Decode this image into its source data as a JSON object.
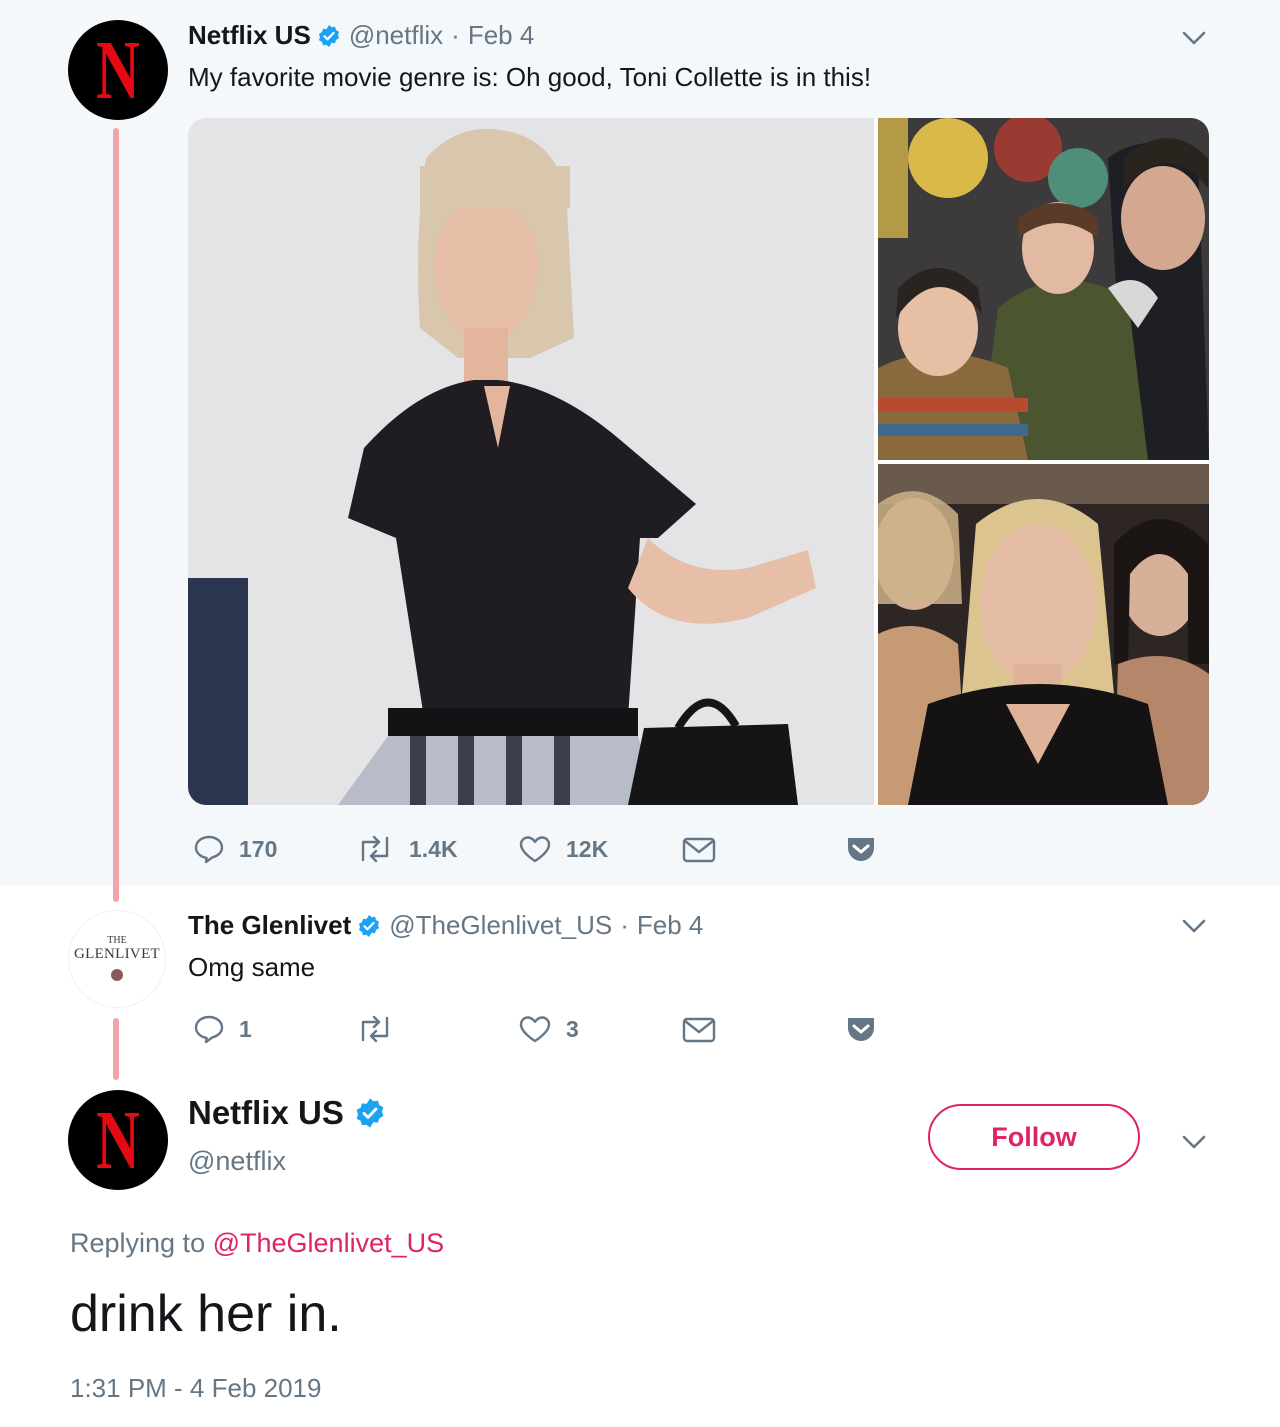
{
  "tweet1": {
    "author_name": "Netflix US",
    "handle": "@netflix",
    "separator": "·",
    "date": "Feb 4",
    "text": "My favorite movie genre is: Oh good, Toni Collette is in this!",
    "actions": {
      "replies": "170",
      "retweets": "1.4K",
      "likes": "12K"
    }
  },
  "tweet2": {
    "author_name": "The Glenlivet",
    "handle": "@TheGlenlivet_US",
    "separator": "·",
    "date": "Feb 4",
    "text": "Omg same",
    "actions": {
      "replies": "1",
      "retweets": "",
      "likes": "3"
    },
    "avatar_text": {
      "line1": "THE",
      "line2": "GLENLIVET"
    }
  },
  "tweet3": {
    "author_name": "Netflix US",
    "handle": "@netflix",
    "follow_label": "Follow",
    "replying_prefix": "Replying to",
    "replying_to": "@TheGlenlivet_US",
    "text": "drink her in.",
    "timestamp": "1:31 PM - 4 Feb 2019"
  },
  "avatar_letter": "N",
  "colors": {
    "brand_red": "#e50914",
    "accent_pink": "#e0245e",
    "verified_blue": "#1da1f2",
    "thread_line": "#f1a5ab",
    "muted": "#657786"
  },
  "icons": [
    "reply-icon",
    "retweet-icon",
    "like-icon",
    "dm-icon",
    "pocket-icon",
    "chevron-down-icon",
    "verified-badge-icon"
  ]
}
